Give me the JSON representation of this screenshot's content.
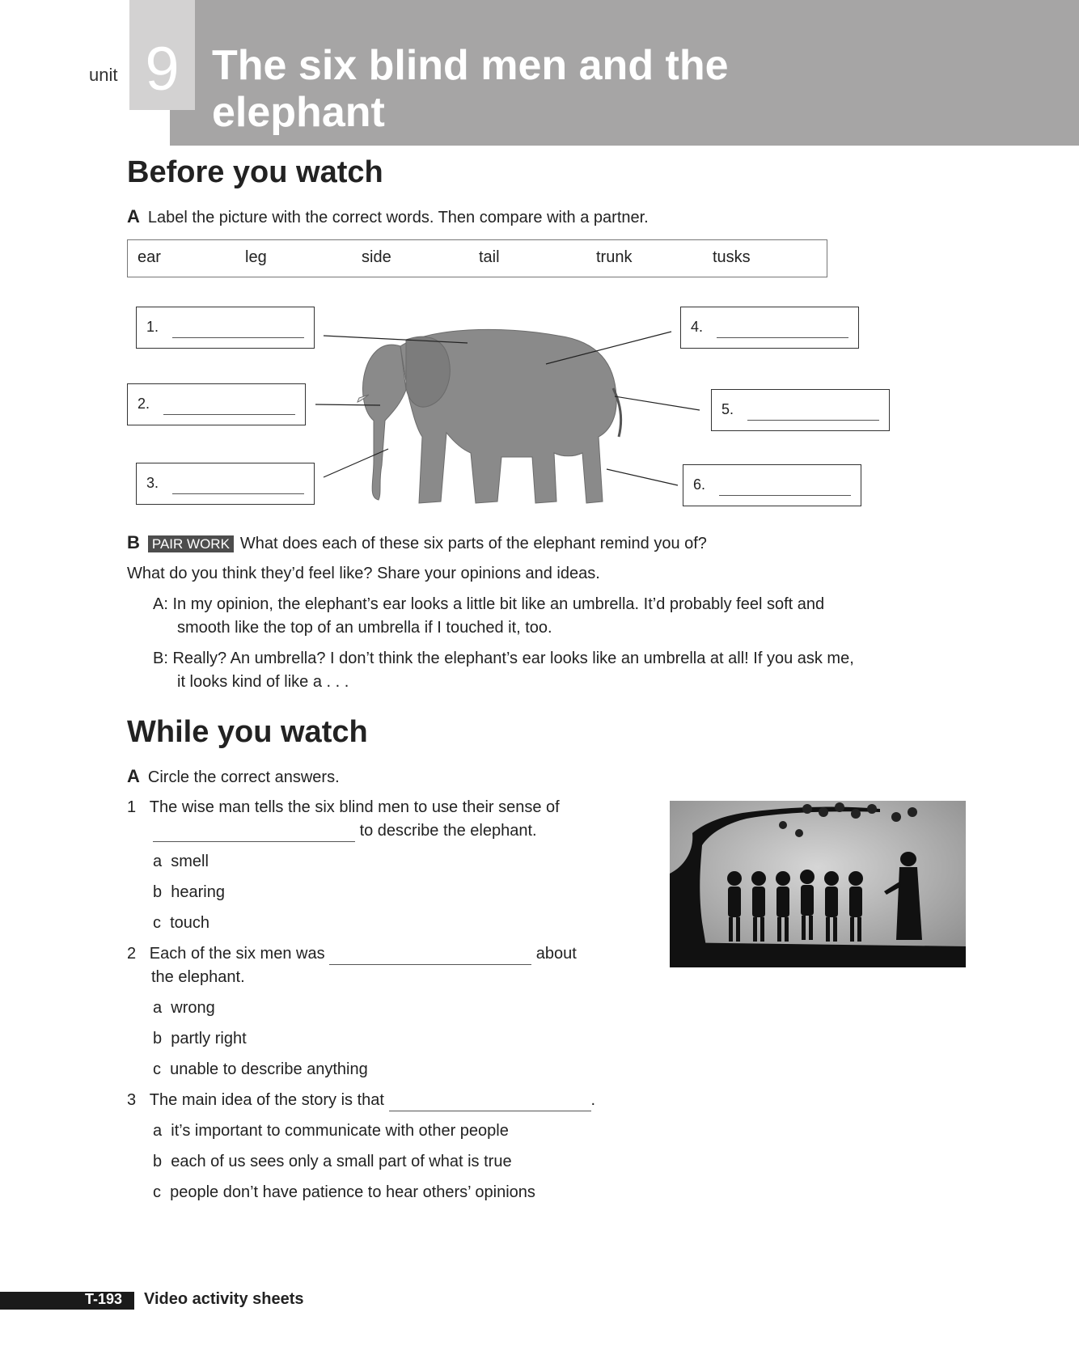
{
  "header": {
    "unit_word": "unit",
    "unit_number": "9",
    "title": "The six blind men and the elephant"
  },
  "before": {
    "heading": "Before you watch",
    "a_letter": "A",
    "a_instruction": "Label the picture with the correct words. Then compare with a partner.",
    "words": [
      "ear",
      "leg",
      "side",
      "tail",
      "trunk",
      "tusks"
    ],
    "labels": [
      "1.",
      "2.",
      "3.",
      "4.",
      "5.",
      "6."
    ],
    "b_letter": "B",
    "b_tag": "PAIR WORK",
    "b_instruction_1": "What does each of these six parts of the elephant remind you of?",
    "b_instruction_2": "What do you think they’d feel like? Share your opinions and ideas.",
    "dialog_a_1": "A: In my opinion, the elephant’s ear looks a little bit like an umbrella. It’d probably feel soft and",
    "dialog_a_2": "smooth like the top of an umbrella if I touched it, too.",
    "dialog_b_1": "B: Really? An umbrella? I don’t think the elephant’s ear looks like an umbrella at all! If you ask me,",
    "dialog_b_2": "it looks kind of like a . . ."
  },
  "while": {
    "heading": "While you watch",
    "a_letter": "A",
    "a_instruction": "Circle the correct answers.",
    "q1": {
      "num": "1",
      "text_1": "The wise man tells the six blind men to use their sense of",
      "text_2": "to describe the elephant.",
      "options": [
        {
          "letter": "a",
          "text": "smell"
        },
        {
          "letter": "b",
          "text": "hearing"
        },
        {
          "letter": "c",
          "text": "touch"
        }
      ]
    },
    "q2": {
      "num": "2",
      "text_1": "Each of the six men was",
      "text_1b": "about",
      "text_2": "the elephant.",
      "options": [
        {
          "letter": "a",
          "text": "wrong"
        },
        {
          "letter": "b",
          "text": "partly right"
        },
        {
          "letter": "c",
          "text": "unable to describe anything"
        }
      ]
    },
    "q3": {
      "num": "3",
      "text_1": "The main idea of the story is that",
      "text_end": ".",
      "options": [
        {
          "letter": "a",
          "text": "it’s important to communicate with other people"
        },
        {
          "letter": "b",
          "text": "each of us sees only a small part of what is true"
        },
        {
          "letter": "c",
          "text": "people don’t have patience to hear others’ opinions"
        }
      ]
    }
  },
  "footer": {
    "page": "T-193",
    "label": "Video activity sheets"
  }
}
